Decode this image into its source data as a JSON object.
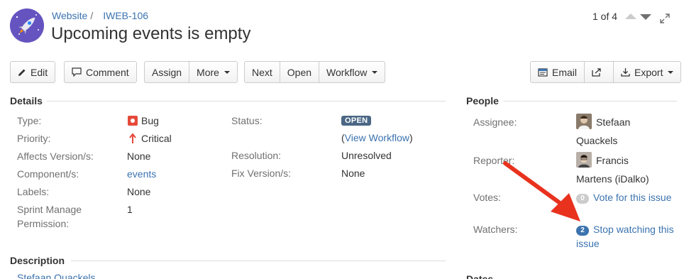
{
  "header": {
    "breadcrumb_project": "Website",
    "breadcrumb_separator": "/",
    "breadcrumb_issue": "IWEB-106",
    "summary": "Upcoming events is empty",
    "pager": "1 of 4"
  },
  "toolbar": {
    "edit": "Edit",
    "comment": "Comment",
    "assign": "Assign",
    "more": "More",
    "next": "Next",
    "open": "Open",
    "workflow": "Workflow",
    "email": "Email",
    "export": "Export"
  },
  "details": {
    "title": "Details",
    "type_label": "Type:",
    "type_value": "Bug",
    "priority_label": "Priority:",
    "priority_value": "Critical",
    "affects_label": "Affects Version/s:",
    "affects_value": "None",
    "component_label": "Component/s:",
    "component_value": "events",
    "labels_label": "Labels:",
    "labels_value": "None",
    "sprint_label_1": "Sprint Manage",
    "sprint_label_2": "Permission:",
    "sprint_value": "1",
    "status_label": "Status:",
    "status_value": "OPEN",
    "view_workflow_open": "(",
    "view_workflow": "View Workflow",
    "view_workflow_close": ")",
    "resolution_label": "Resolution:",
    "resolution_value": "Unresolved",
    "fix_label": "Fix Version/s:",
    "fix_value": "None"
  },
  "people": {
    "title": "People",
    "assignee_label": "Assignee:",
    "assignee_line1": "Stefaan",
    "assignee_line2": "Quackels",
    "reporter_label": "Reporter:",
    "reporter_line1": "Francis",
    "reporter_line2": "Martens (iDalko)",
    "votes_label": "Votes:",
    "votes_count": "0",
    "votes_link": "Vote for this issue",
    "watchers_label": "Watchers:",
    "watchers_count": "2",
    "watchers_link_1": "Stop watching this",
    "watchers_link_2": "issue"
  },
  "description": {
    "title": "Description",
    "author_partial": "Stefaan Quackels"
  },
  "dates": {
    "title_partial": "Dates"
  },
  "colors": {
    "link": "#3b73af",
    "status_lozenge": "#4a6785",
    "bug": "#e5493a",
    "annotation_arrow": "#e8321e"
  }
}
